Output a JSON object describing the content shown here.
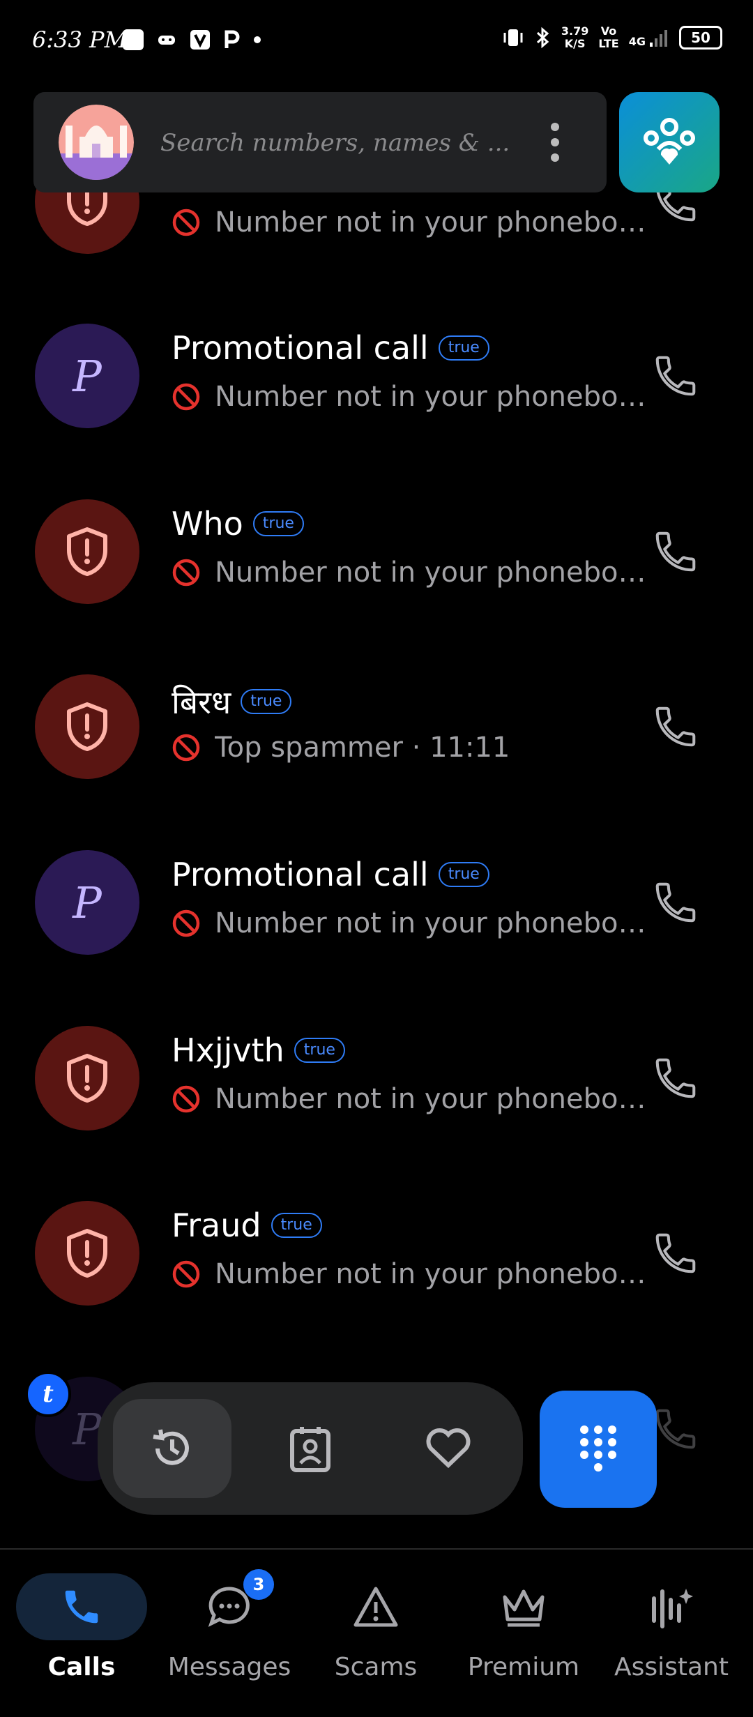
{
  "status_bar": {
    "time": "6:33 PM",
    "network_speed_value": "3.79",
    "network_speed_unit": "K/S",
    "volte_top": "Vo",
    "volte_bottom": "LTE",
    "network_type": "4G",
    "battery": "50"
  },
  "search": {
    "placeholder": "Search numbers, names & ..."
  },
  "calls": [
    {
      "name": "",
      "badge": "true",
      "subtitle": "Number not in your phonebook",
      "avatar_type": "spam",
      "letter": ""
    },
    {
      "name": "Promotional call",
      "badge": "true",
      "subtitle": "Number not in your phonebook",
      "avatar_type": "promo",
      "letter": "P"
    },
    {
      "name": "Who",
      "badge": "true",
      "subtitle": "Number not in your phonebook",
      "avatar_type": "spam",
      "letter": ""
    },
    {
      "name": "बिरध",
      "badge": "true",
      "subtitle": "Top spammer · 11:11",
      "avatar_type": "spam",
      "letter": ""
    },
    {
      "name": "Promotional call",
      "badge": "true",
      "subtitle": "Number not in your phonebook",
      "avatar_type": "promo",
      "letter": "P"
    },
    {
      "name": "Hxjjvth",
      "badge": "true",
      "subtitle": "Number not in your phonebook",
      "avatar_type": "spam",
      "letter": ""
    },
    {
      "name": "Fraud",
      "badge": "true",
      "subtitle": "Number not in your phonebook",
      "avatar_type": "spam",
      "letter": ""
    },
    {
      "name": "",
      "badge": "",
      "subtitle": "",
      "avatar_type": "promo",
      "letter": "P"
    }
  ],
  "floating": {
    "t_badge": "t",
    "segments": [
      "history-icon",
      "contacts-icon",
      "favorites-icon"
    ],
    "dialpad_icon": "dialpad-icon"
  },
  "bottom_nav": {
    "items": [
      {
        "label": "Calls",
        "icon": "phone-icon",
        "active": true
      },
      {
        "label": "Messages",
        "icon": "chat-icon",
        "count": "3"
      },
      {
        "label": "Scams",
        "icon": "warning-icon"
      },
      {
        "label": "Premium",
        "icon": "crown-icon"
      },
      {
        "label": "Assistant",
        "icon": "assistant-icon"
      }
    ]
  },
  "colors": {
    "accent": "#1a73f0",
    "spam_avatar": "#5a1512",
    "promo_avatar": "#2b1a55",
    "block_red": "#e5322d"
  }
}
